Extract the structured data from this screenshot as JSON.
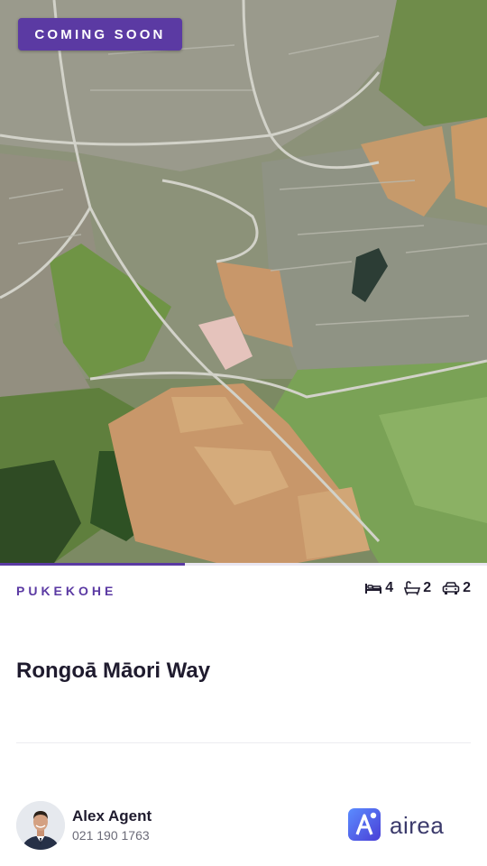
{
  "listing": {
    "status_badge": "COMING SOON",
    "suburb": "PUKEKOHE",
    "address": "Rongoā Māori Way",
    "bedrooms": "4",
    "bathrooms": "2",
    "parking": "2",
    "gallery_progress": 0.38
  },
  "agent": {
    "name": "Alex Agent",
    "phone": "021 190 1763"
  },
  "brand": {
    "name": "airea"
  },
  "colors": {
    "accent": "#5b3aa3",
    "text": "#1f1b2e",
    "muted": "#6b6b78",
    "brand_icon": "#4f6ff0"
  },
  "icons": [
    "bed-icon",
    "bath-icon",
    "car-icon",
    "airea-logo-icon"
  ]
}
